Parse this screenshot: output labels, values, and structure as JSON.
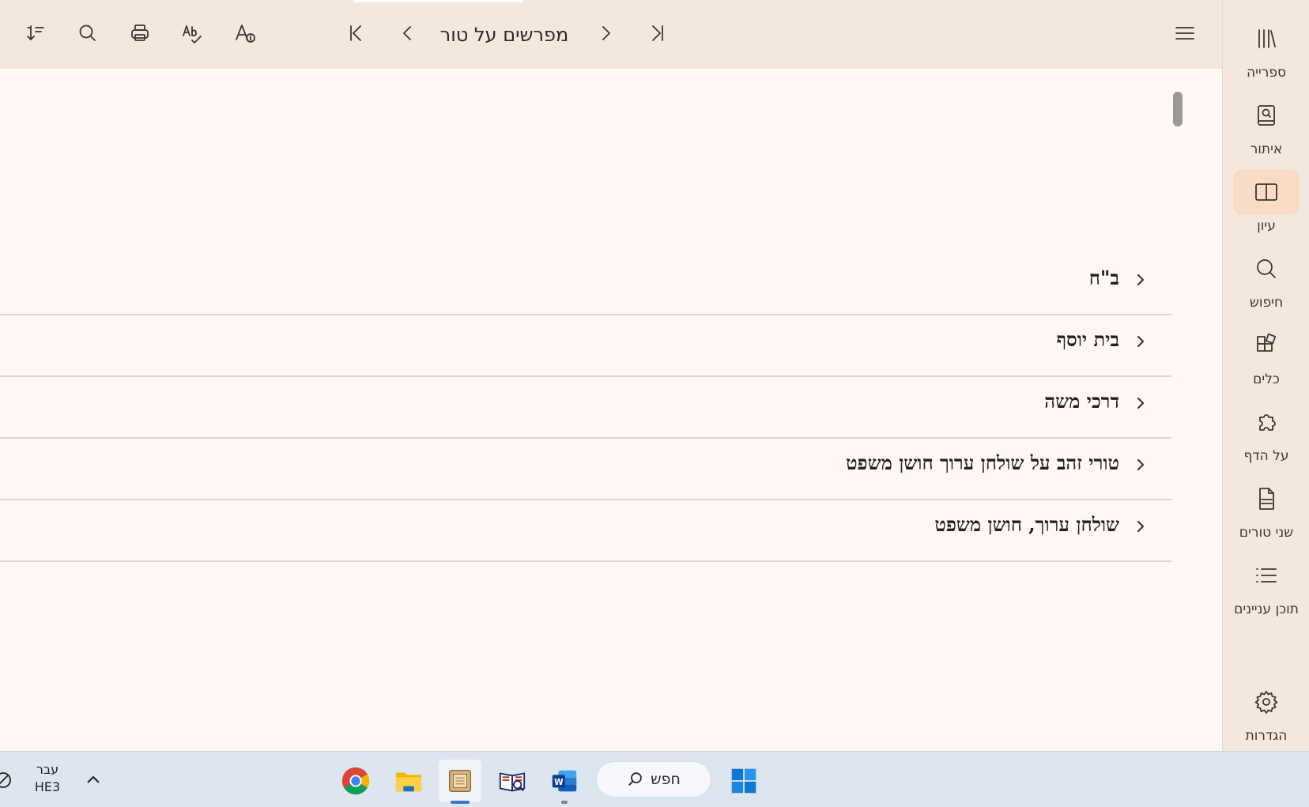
{
  "toolbar": {
    "title": "מפרשים על טור",
    "icons": [
      "sort-icon",
      "search-icon",
      "print-icon",
      "spellcheck-icon",
      "font-info-icon",
      "first-page-icon",
      "previous-icon",
      "next-icon",
      "last-page-icon",
      "menu-icon"
    ]
  },
  "rail": {
    "items": [
      {
        "label": "ספרייה",
        "icon": "library-icon"
      },
      {
        "label": "איתור",
        "icon": "locate-book-icon"
      },
      {
        "label": "עיון",
        "icon": "open-book-icon",
        "active": true
      },
      {
        "label": "חיפוש",
        "icon": "search-icon"
      },
      {
        "label": "כלים",
        "icon": "tools-icon"
      },
      {
        "label": "על הדף",
        "icon": "puzzle-icon"
      },
      {
        "label": "שני טורים",
        "icon": "pdf-icon"
      },
      {
        "label": "תוכן עניינים",
        "icon": "list-icon"
      },
      {
        "label": "הגדרות",
        "icon": "gear-icon"
      }
    ]
  },
  "list": {
    "items": [
      {
        "label": "ב\"ח"
      },
      {
        "label": "בית יוסף"
      },
      {
        "label": "דרכי משה"
      },
      {
        "label": "טורי זהב על שולחן ערוך חושן משפט"
      },
      {
        "label": "שולחן ערוך, חושן משפט"
      }
    ]
  },
  "taskbar": {
    "search_label": "חפש",
    "lang_top": "עבר",
    "lang_bottom": "HE3",
    "apps": [
      "chrome-icon",
      "file-explorer-icon",
      "otzaria-app-icon",
      "dictionary-app-icon",
      "word-icon",
      "windows-start-icon"
    ]
  }
}
